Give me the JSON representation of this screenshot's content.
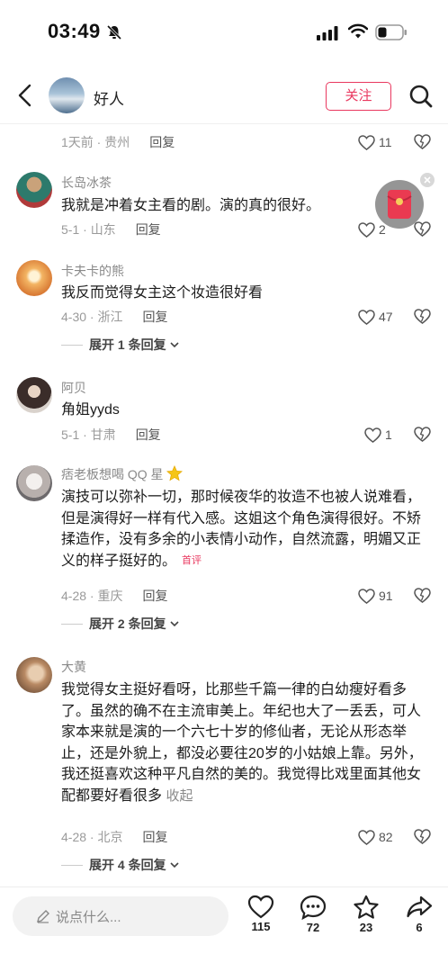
{
  "status": {
    "time": "03:49"
  },
  "header": {
    "title": "好人",
    "follow_label": "关注"
  },
  "partial": {
    "time": "1天前",
    "location": "贵州",
    "reply": "回复",
    "likes": "11"
  },
  "comments": [
    {
      "username": "长岛冰茶",
      "text": "我就是冲着女主看的剧。演的真的很好。",
      "time": "5-1",
      "location": "山东",
      "reply": "回复",
      "likes": "2"
    },
    {
      "username": "卡夫卡的熊",
      "text": "我反而觉得女主这个妆造很好看",
      "time": "4-30",
      "location": "浙江",
      "reply": "回复",
      "likes": "47",
      "expand": "展开 1 条回复"
    },
    {
      "username": "阿贝",
      "text": "角姐yyds",
      "time": "5-1",
      "location": "甘肃",
      "reply": "回复",
      "likes": "1"
    },
    {
      "username": "痞老板想喝 QQ 星",
      "text": "演技可以弥补一切，那时候夜华的妆造不也被人说难看，但是演得好一样有代入感。这姐这个角色演得很好。不矫揉造作，没有多余的小表情小动作，自然流露，明媚又正义的样子挺好的。",
      "tag": "首评",
      "time": "4-28",
      "location": "重庆",
      "reply": "回复",
      "likes": "91",
      "expand": "展开 2 条回复"
    },
    {
      "username": "大黄",
      "text": "我觉得女主挺好看呀，比那些千篇一律的白幼瘦好看多了。虽然的确不在主流审美上。年纪也大了一丢丢，可人家本来就是演的一个六七十岁的修仙者，无论从形态举止，还是外貌上，都没必要往20岁的小姑娘上靠。另外，我还挺喜欢这种平凡自然的美的。我觉得比戏里面其他女配都要好看很多",
      "collapse": "收起",
      "time": "4-28",
      "location": "北京",
      "reply": "回复",
      "likes": "82",
      "expand": "展开 4 条回复"
    }
  ],
  "bottom": {
    "placeholder": "说点什么...",
    "likes": "115",
    "comments": "72",
    "favorites": "23",
    "shares": "6"
  },
  "colors": {
    "accent": "#e9385f"
  }
}
